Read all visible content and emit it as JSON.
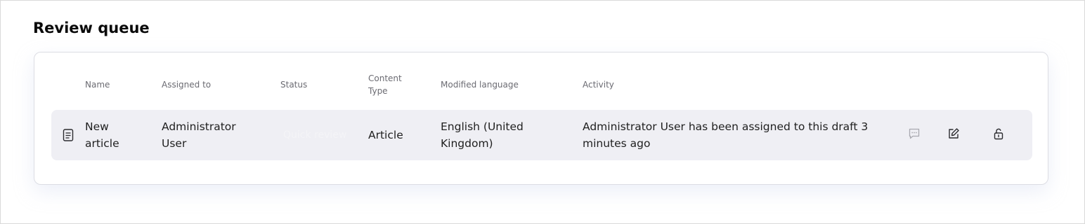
{
  "section": {
    "title": "Review queue"
  },
  "table": {
    "headers": {
      "name": "Name",
      "assigned_to": "Assigned to",
      "status": "Status",
      "content_type_line1": "Content",
      "content_type_line2": "Type",
      "modified_language": "Modified language",
      "activity": "Activity"
    },
    "rows": [
      {
        "icon": "document-icon",
        "name_line1": "New",
        "name_line2": "article",
        "assigned_line1": "Administrator",
        "assigned_line2": "User",
        "status": "Quick review",
        "content_type": "Article",
        "language_line1": "English (United",
        "language_line2": "Kingdom)",
        "activity_line1": "Administrator User has been assigned to this draft 3",
        "activity_line2": "minutes ago",
        "actions": [
          "comment-icon",
          "edit-icon",
          "unlock-icon"
        ]
      }
    ]
  },
  "colors": {
    "row_background": "#efeff4",
    "header_text": "#6b6b72",
    "comment_icon": "#a9a9b0",
    "action_icon": "#2b2b2f"
  }
}
